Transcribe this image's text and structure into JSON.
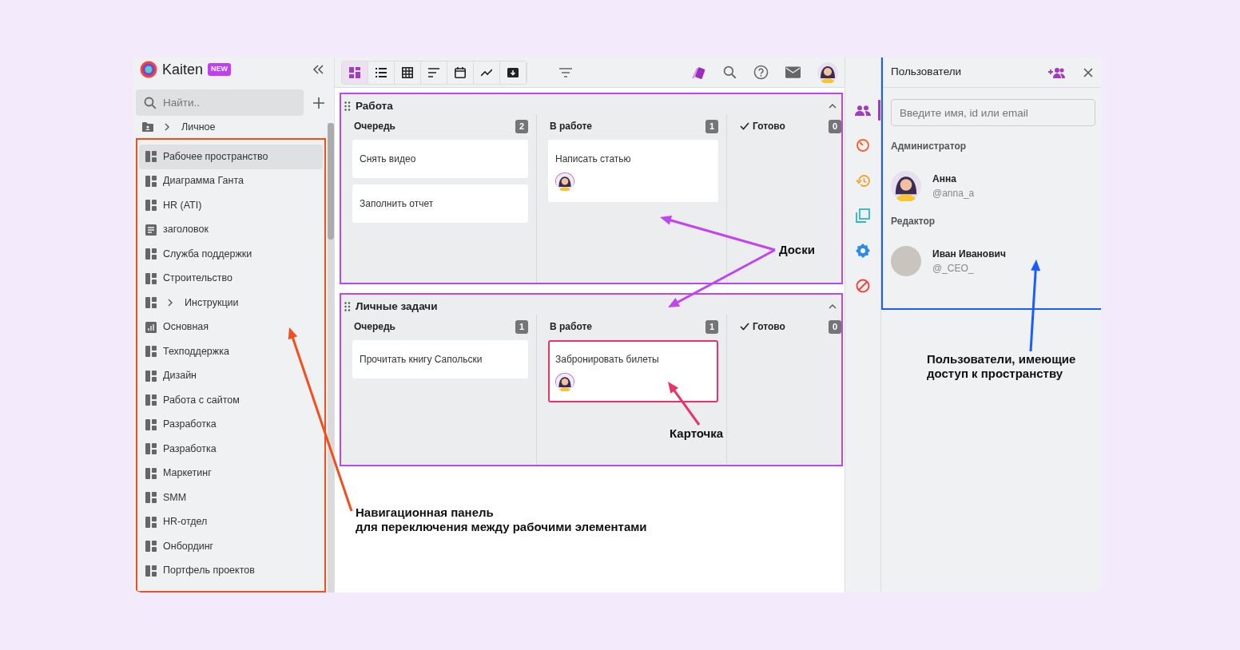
{
  "sidebar": {
    "logo": "Kaiten",
    "badge": "NEW",
    "search": {
      "placeholder": "Найти.."
    },
    "highlighted": true,
    "items": [
      {
        "label": "Личное",
        "kind": "folder",
        "expandable": true,
        "selected": false
      },
      {
        "label": "Рабочее пространство",
        "kind": "board",
        "expandable": false,
        "selected": true
      },
      {
        "label": "Диаграмма Ганта",
        "kind": "board",
        "expandable": false,
        "selected": false
      },
      {
        "label": "HR (ATI)",
        "kind": "board",
        "expandable": false,
        "selected": false
      },
      {
        "label": "заголовок",
        "kind": "document",
        "expandable": false,
        "selected": false
      },
      {
        "label": "Служба поддержки",
        "kind": "board",
        "expandable": false,
        "selected": false
      },
      {
        "label": "Строительство",
        "kind": "board",
        "expandable": false,
        "selected": false
      },
      {
        "label": "Инструкции",
        "kind": "board",
        "expandable": true,
        "selected": false
      },
      {
        "label": "Основная",
        "kind": "chart",
        "expandable": false,
        "selected": false
      },
      {
        "label": "Техподдержка",
        "kind": "board",
        "expandable": false,
        "selected": false
      },
      {
        "label": "Дизайн",
        "kind": "board",
        "expandable": false,
        "selected": false
      },
      {
        "label": "Работа с сайтом",
        "kind": "board",
        "expandable": false,
        "selected": false
      },
      {
        "label": "Разработка",
        "kind": "board",
        "expandable": false,
        "selected": false
      },
      {
        "label": "Разработка",
        "kind": "board",
        "expandable": false,
        "selected": false
      },
      {
        "label": "Маркетинг",
        "kind": "board",
        "expandable": false,
        "selected": false
      },
      {
        "label": "SMM",
        "kind": "board",
        "expandable": false,
        "selected": false
      },
      {
        "label": "HR-отдел",
        "kind": "board",
        "expandable": false,
        "selected": false
      },
      {
        "label": "Онбординг",
        "kind": "board",
        "expandable": false,
        "selected": false
      },
      {
        "label": "Портфель проектов",
        "kind": "board",
        "expandable": false,
        "selected": false
      }
    ]
  },
  "toolbar": {
    "views": [
      {
        "kind": "boards",
        "selected": true
      },
      {
        "kind": "list",
        "selected": false
      },
      {
        "kind": "table",
        "selected": false
      },
      {
        "kind": "timeline",
        "selected": false
      },
      {
        "kind": "calendar",
        "selected": false
      },
      {
        "kind": "chart",
        "selected": false
      },
      {
        "kind": "archive",
        "selected": false
      }
    ]
  },
  "boards": [
    {
      "title": "Работа",
      "highlighted": true,
      "columns": [
        {
          "title": "Очередь",
          "count": "2",
          "kind": "regular",
          "cards": [
            {
              "title": "Снять видео",
              "has_avatar": false,
              "highlighted": false
            },
            {
              "title": "Заполнить отчет",
              "has_avatar": false,
              "highlighted": false
            }
          ]
        },
        {
          "title": "В работе",
          "count": "1",
          "kind": "regular",
          "cards": [
            {
              "title": "Написать статью",
              "has_avatar": true,
              "highlighted": false
            }
          ]
        },
        {
          "title": "Готово",
          "count": "0",
          "kind": "done"
        }
      ]
    },
    {
      "title": "Личные задачи",
      "highlighted": true,
      "columns": [
        {
          "title": "Очередь",
          "count": "1",
          "kind": "regular",
          "cards": [
            {
              "title": "Прочитать книгу Сапольски",
              "has_avatar": false,
              "highlighted": false
            }
          ]
        },
        {
          "title": "В работе",
          "count": "1",
          "kind": "regular",
          "cards": [
            {
              "title": "Забронировать билеты",
              "has_avatar": true,
              "highlighted": true
            }
          ]
        },
        {
          "title": "Готово",
          "count": "0",
          "kind": "done"
        }
      ]
    }
  ],
  "rail": [
    {
      "kind": "users",
      "selected": true
    },
    {
      "kind": "timer",
      "selected": false
    },
    {
      "kind": "history",
      "selected": false
    },
    {
      "kind": "copy",
      "selected": false
    },
    {
      "kind": "badge",
      "selected": false
    },
    {
      "kind": "ban",
      "selected": false
    }
  ],
  "users_panel": {
    "title": "Пользователи",
    "highlighted": true,
    "search": {
      "placeholder": "Введите имя, id или email"
    },
    "groups": [
      {
        "role": "Администратор",
        "users": [
          {
            "name": "Анна",
            "handle": "@anna_a",
            "kind": "drawing"
          }
        ]
      },
      {
        "role": "Редактор",
        "users": [
          {
            "name": "Иван Иванович",
            "handle": "@_CEO_",
            "kind": "photo"
          }
        ]
      }
    ]
  },
  "annotations": [
    {
      "kind": "boards",
      "lines": [
        "Доски"
      ],
      "color": "#c044f0"
    },
    {
      "kind": "card",
      "lines": [
        "Карточка"
      ],
      "color": "#e8336b"
    },
    {
      "kind": "navigation",
      "lines": [
        "Навигационная панель",
        "для переключения между рабочими элементами"
      ],
      "color": "#f24e1e"
    },
    {
      "kind": "users",
      "lines": [
        "Пользователи, имеющие",
        "доступ к пространству"
      ],
      "color": "#1a5cff"
    }
  ]
}
